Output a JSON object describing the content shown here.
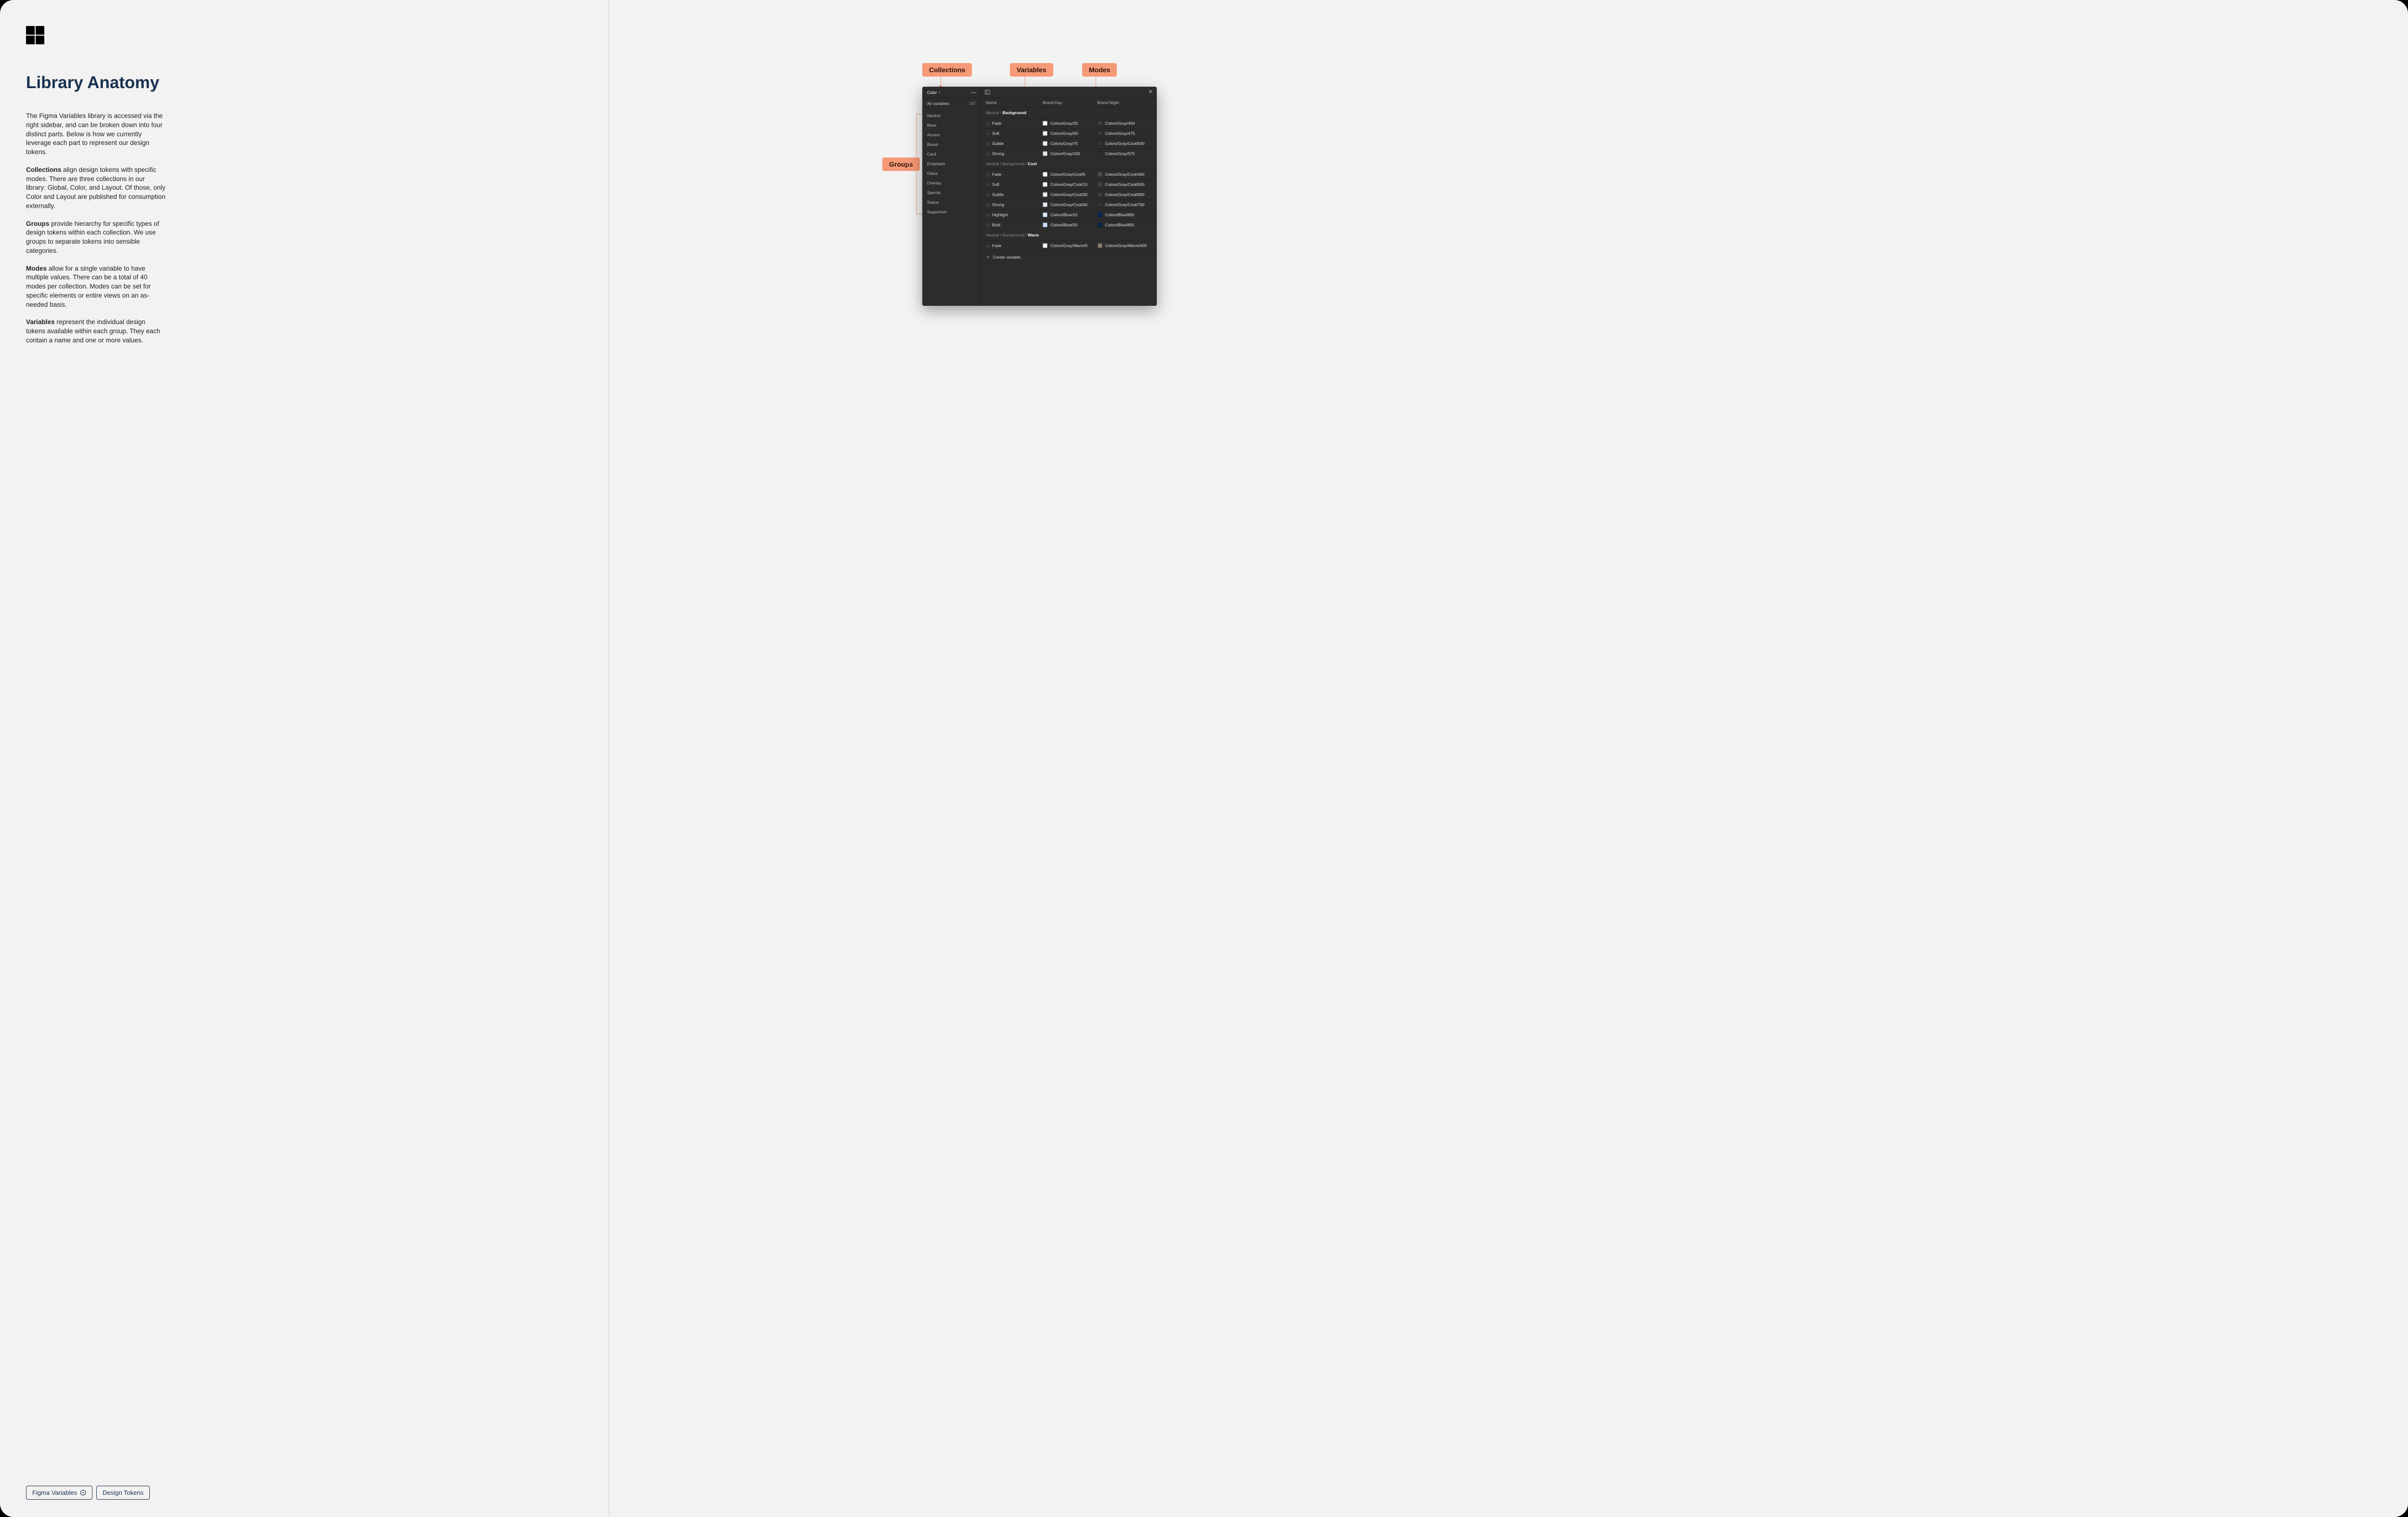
{
  "title": "Library Anatomy",
  "intro": "The Figma Variables library is accessed via the right sidebar, and can be broken down into four distinct parts. Below is how we currently leverage each part to represent our design tokens.",
  "sections": {
    "collections": {
      "heading": "Collections",
      "text": " align design tokens with specific modes. There are three collections in our library: Global, Color, and Layout. Of those, only Color and Layout are published for consumption externally."
    },
    "groups": {
      "heading": "Groups",
      "text": " provide hierarchy for specific types of design tokens within each collection. We use groups to separate tokens into sensible categories."
    },
    "modes": {
      "heading": "Modes",
      "text": " allow for a single variable to have multiple values. There can be a total of 40 modes per collection. Modes can be set for specific elements or entire views on an as-needed basis."
    },
    "variables": {
      "heading": "Variables",
      "text": " represent the individual design tokens available within each group. They each contain a name and one or more values."
    }
  },
  "tags": {
    "figma": "Figma Variables",
    "tokens": "Design Tokens"
  },
  "annotations": {
    "collections": "Collections",
    "variables": "Variables",
    "modes": "Modes",
    "groups": "Groups"
  },
  "panel": {
    "collection_name": "Color",
    "all_variables_label": "All variables",
    "all_variables_count": "287",
    "groups": [
      "Neutral",
      "Base",
      "Accent",
      "Brand",
      "Card",
      "Emphasis",
      "Glass",
      "Overlay",
      "Special",
      "Status",
      "Supportive"
    ],
    "columns": {
      "name": "Name",
      "mode1": "Brand Day",
      "mode2": "Brand Night"
    },
    "sections": [
      {
        "crumb_muted": "Neutral / ",
        "crumb_active": "Background",
        "rows": [
          {
            "name": "Fade",
            "v1": {
              "c": "#f7f7f7",
              "t": "Colors/Gray/25"
            },
            "v2": {
              "c": "#3f3f3f",
              "t": "Colors/Gray/450"
            }
          },
          {
            "name": "Soft",
            "v1": {
              "c": "#f2f2f2",
              "t": "Colors/Gray/50"
            },
            "v2": {
              "c": "#3a3a3a",
              "t": "Colors/Gray/475"
            }
          },
          {
            "name": "Subtle",
            "v1": {
              "c": "#ededed",
              "t": "Colors/Gray/75"
            },
            "v2": {
              "c": "#353535",
              "t": "Colors/Gray/Cool/500"
            }
          },
          {
            "name": "Strong",
            "v1": {
              "c": "#e6e6e6",
              "t": "Colors/Gray/100"
            },
            "v2": {
              "c": "#2e2e2e",
              "t": "Colors/Gray/575"
            }
          }
        ]
      },
      {
        "crumb_muted": "Neutral / Background / ",
        "crumb_active": "Cool",
        "rows": [
          {
            "name": "Fade",
            "v1": {
              "c": "#f6f8fa",
              "t": "Colors/Gray/Cool/5"
            },
            "v2": {
              "c": "#4a4e52",
              "t": "Colors/Gray/Cool/400"
            }
          },
          {
            "name": "Soft",
            "v1": {
              "c": "#f1f4f7",
              "t": "Colors/Gray/Cool/10"
            },
            "v2": {
              "c": "#43474b",
              "t": "Colors/Gray/Cool/500"
            }
          },
          {
            "name": "Subtle",
            "v1": {
              "c": "#eaeef2",
              "t": "Colors/Gray/Cool/20"
            },
            "v2": {
              "c": "#3c4044",
              "t": "Colors/Gray/Cool/600"
            }
          },
          {
            "name": "Strong",
            "v1": {
              "c": "#e2e8ee",
              "t": "Colors/Gray/Cool/40"
            },
            "v2": {
              "c": "#34383c",
              "t": "Colors/Gray/Cool/700"
            }
          },
          {
            "name": "Highlight",
            "v1": {
              "c": "#dce9fb",
              "t": "Colors/Blue/10"
            },
            "v2": {
              "c": "#0a2a55",
              "t": "Colors/Blue/800"
            }
          },
          {
            "name": "Bold",
            "v1": {
              "c": "#c9ddf7",
              "t": "Colors/Blue/20"
            },
            "v2": {
              "c": "#0a2a55",
              "t": "Colors/Blue/800"
            }
          }
        ]
      },
      {
        "crumb_muted": "Neutral / Background / ",
        "crumb_active": "Warm",
        "rows": [
          {
            "name": "Fade",
            "v1": {
              "c": "#f8f6f4",
              "t": "Colors/Gray/Warm/5"
            },
            "v2": {
              "c": "#8a7f73",
              "t": "Colors/Gray/Warm/400"
            }
          }
        ]
      }
    ],
    "create_label": "Create variable"
  }
}
